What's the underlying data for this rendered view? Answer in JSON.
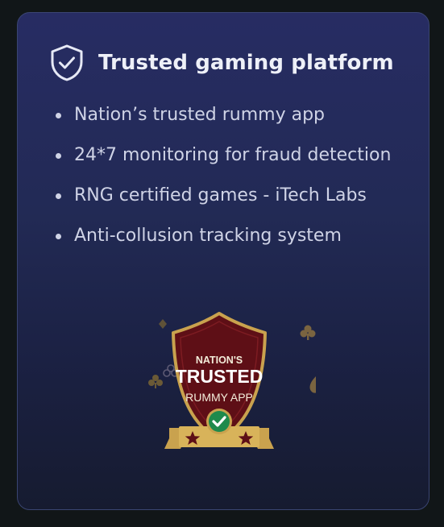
{
  "card": {
    "title": "Trusted gaming platform",
    "title_icon": "shield-check-icon",
    "features": [
      "Nation’s trusted rummy app",
      "24*7 monitoring for fraud detection",
      "RNG certified games - iTech Labs",
      "Anti-collusion tracking system"
    ],
    "badge": {
      "line1": "NATION'S",
      "line2": "TRUSTED",
      "line3": "RUMMY APP",
      "icons": [
        "check-circle-icon",
        "star-icon",
        "club-suit-icon",
        "spade-suit-icon",
        "diamond-suit-icon"
      ]
    }
  },
  "colors": {
    "page_background": "#111618",
    "card_gradient_top": "#272c63",
    "card_gradient_bottom": "#161b30",
    "title_text": "#eef0f8",
    "body_text": "#cfd3e6",
    "badge_maroon": "#5e0f16",
    "badge_gold": "#c9a24e",
    "check_green": "#1f8a4c"
  }
}
